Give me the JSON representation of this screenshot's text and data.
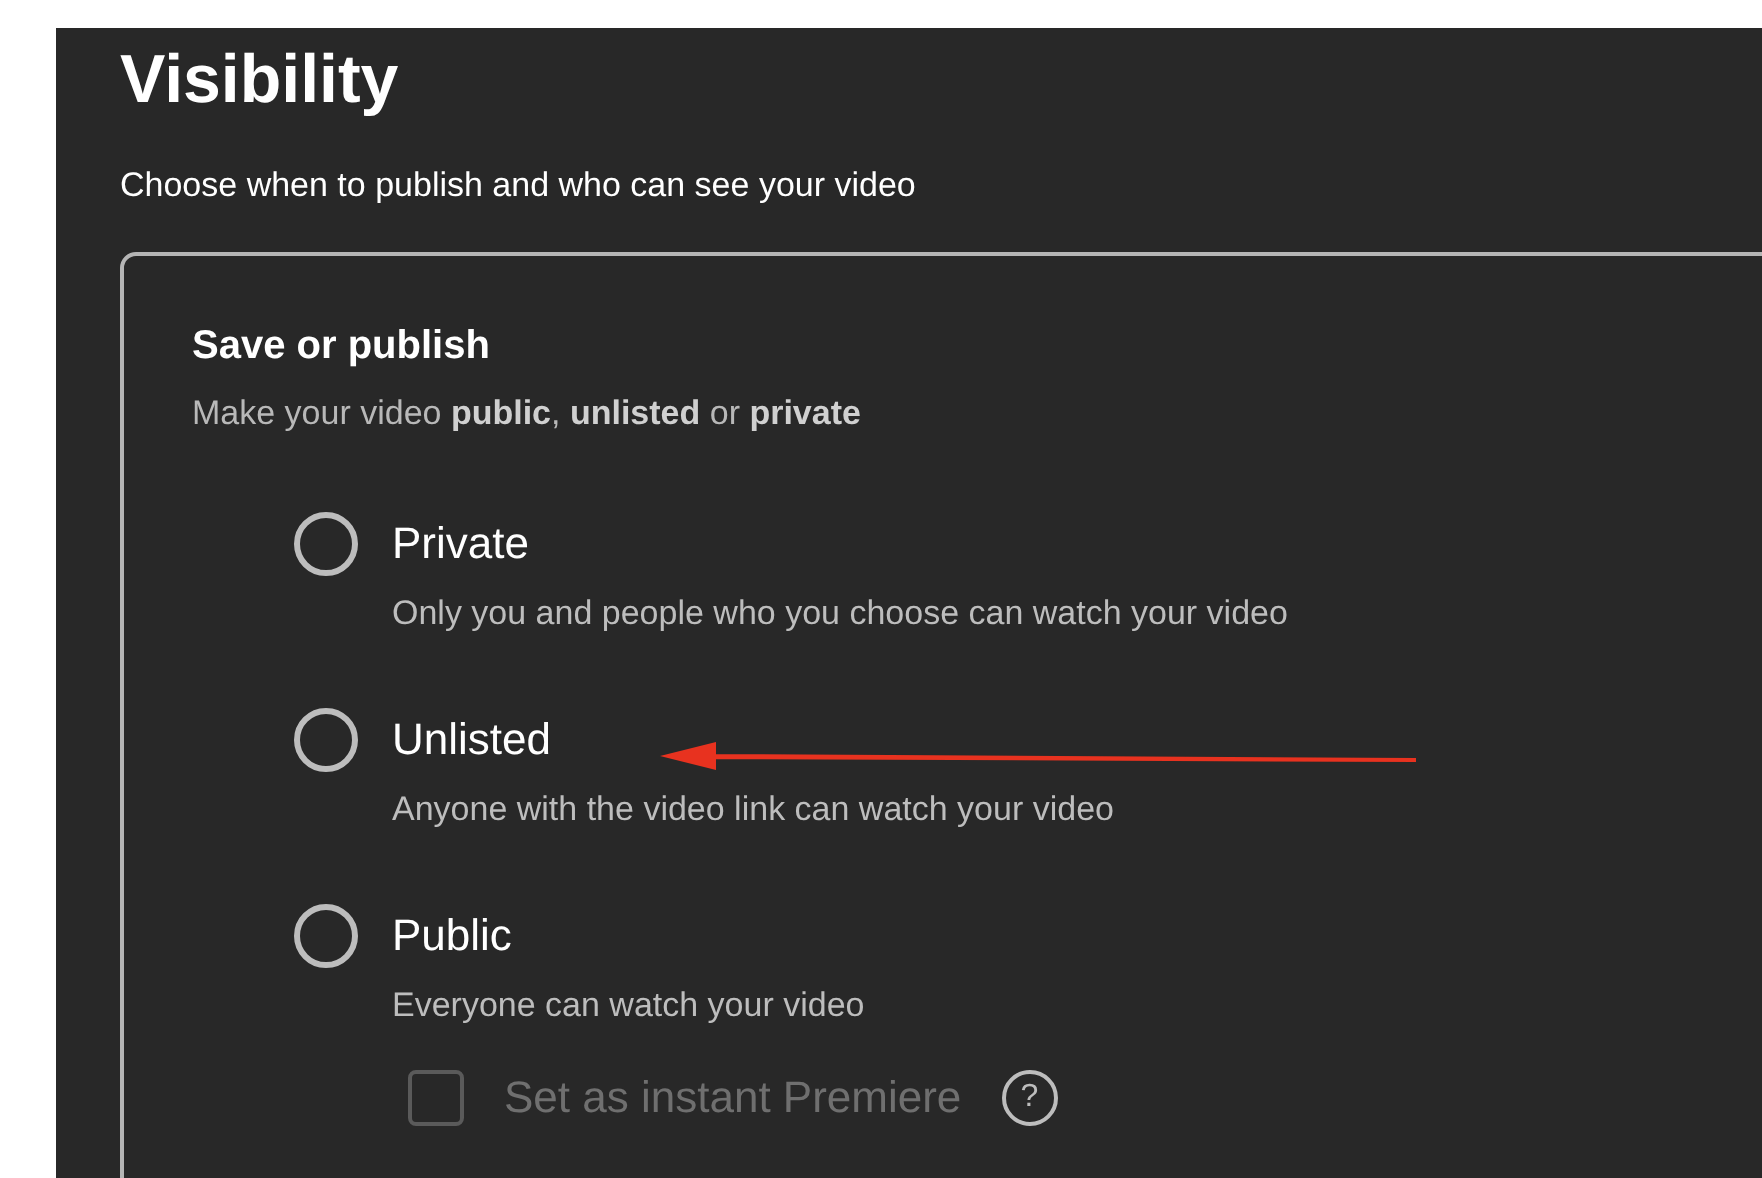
{
  "title": "Visibility",
  "subtitle": "Choose when to publish and who can see your video",
  "section": {
    "title": "Save or publish",
    "description": "Make your video **public**, **unlisted** or **private**"
  },
  "options": [
    {
      "label": "Private",
      "description": "Only you and people who you choose can watch your video",
      "selected": false
    },
    {
      "label": "Unlisted",
      "description": "Anyone with the video link can watch your video",
      "selected": false
    },
    {
      "label": "Public",
      "description": "Everyone can watch your video",
      "selected": false
    }
  ],
  "premiere": {
    "label": "Set as instant Premiere",
    "checked": false,
    "disabled": true,
    "help": "?"
  }
}
